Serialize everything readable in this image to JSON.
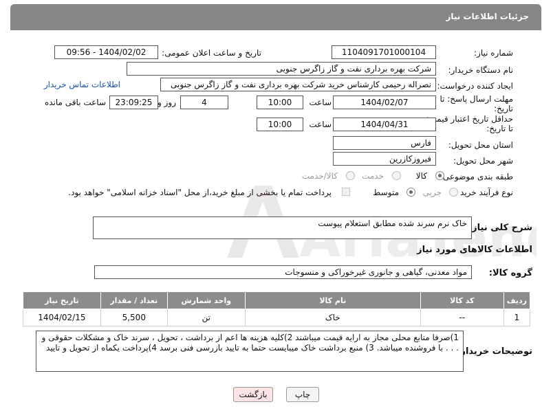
{
  "header": {
    "title": "جزئیات اطلاعات نیاز"
  },
  "form": {
    "need_number_label": "شماره نیاز:",
    "need_number": "1104091701000104",
    "announce_label": "تاریخ و ساعت اعلان عمومی:",
    "announce_value": "1404/02/02 - 09:56",
    "buyer_org_label": "نام دستگاه خریدار:",
    "buyer_org": "شرکت بهره برداری نفت و گاز زاگرس جنوبی",
    "creator_label": "ایجاد کننده درخواست:",
    "creator": "نصراله رحیمی کارشناس خرید شرکت بهره برداری نفت و گاز زاگرس جنوبی",
    "contact_link": "اطلاعات تماس خریدار",
    "reply_deadline_label_1": "مهلت ارسال پاسخ: تا",
    "reply_deadline_label_2": "تاریخ:",
    "reply_date": "1404/02/07",
    "time_label": "ساعت",
    "reply_time": "10:00",
    "days_value": "4",
    "days_label": "روز و",
    "remaining_time": "23:09:25",
    "remaining_label": "ساعت باقی مانده",
    "validity_label_1": "حداقل تاریخ اعتبار قیمت:",
    "validity_label_2": "تا تاریخ:",
    "validity_date": "1404/04/31",
    "validity_time": "10:00",
    "province_label": "استان محل تحویل:",
    "province": "فارس",
    "city_label": "شهر محل تحویل:",
    "city": "فیروزکازرین",
    "category_label": "طبقه بندی موضوعی:",
    "category_options": [
      "کالا",
      "خدمت",
      "کالا/خدمت"
    ],
    "category_selected": "کالا",
    "process_label": "نوع فرآیند خرید :",
    "process_options": [
      "جزیی",
      "متوسط"
    ],
    "process_selected": "متوسط",
    "payment_note": "پرداخت تمام یا بخشی از مبلغ خرید،از محل \"اسناد خزانه اسلامی\" خواهد بود."
  },
  "description": {
    "label": "شرح کلی نیاز:",
    "value": "خاک نرم سرند شده مطابق استعلام پیوست"
  },
  "goods": {
    "section_title": "اطلاعات کالاهای مورد نیاز",
    "group_label": "گروه کالا:",
    "group_value": "مواد معدنی، گیاهی و جانوری غیرخوراکی و منسوجات",
    "columns": [
      "ردیف",
      "کد کالا",
      "نام کالا",
      "واحد شمارش",
      "تعداد / مقدار",
      "تاریخ نیاز"
    ],
    "rows": [
      [
        "1",
        "--",
        "خاک",
        "تن",
        "5,500",
        "1404/02/15"
      ]
    ]
  },
  "buyer_notes": {
    "label": "توضیحات خریدار:",
    "text": "1)صرفا منابع محلی مجاز به ارایه قیمت میباشند 2)کلیه هزینه ها اعم از برداشت ، تحویل ، سرند خاک و مشکلات حقوقی و . . . با فروشنده میباشد. 3) منبع برداشت خاک میبایست حتما به تایید بازرسی فنی برسد  4)پرداخت یکماه از تحویل و تایید"
  },
  "buttons": {
    "print": "چاپ",
    "back": "بازگشت"
  },
  "watermark": {
    "text": "AriaTender.neT"
  },
  "colors": {
    "header_bg": "#868686",
    "table_header_bg": "#8c8c8c",
    "link": "#1a4fb5",
    "back_button_bg": "#fde4e4"
  }
}
